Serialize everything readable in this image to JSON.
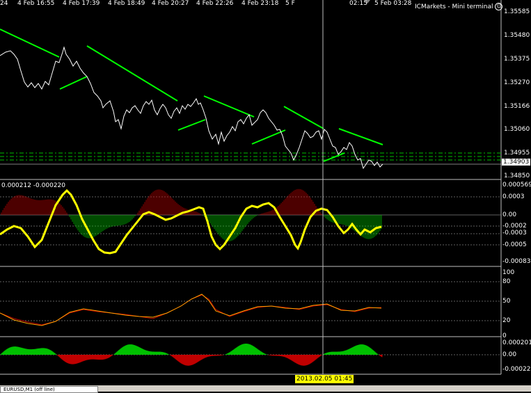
{
  "terminal": {
    "title": "ICMarkets - Mini terminal",
    "smiley": "☺"
  },
  "price_axis": [
    "1.35585",
    "1.35480",
    "1.35375",
    "1.35270",
    "1.35166",
    "1.35060",
    "1.34955",
    "1.34850"
  ],
  "current_price": "1.34903",
  "macd": {
    "header": "0.000212 -0.000220",
    "axis": [
      "0.000569",
      "0.0003",
      "0.00",
      "-0.0002",
      "-0.0003",
      "-0.0005",
      "-0.00083"
    ]
  },
  "oscillator_axis": [
    "100",
    "80",
    "50",
    "20",
    "0"
  ],
  "ao_axis": [
    "0.000201",
    "0.00",
    "-0.000222"
  ],
  "time_axis": [
    "24",
    "4 Feb 16:55",
    "4 Feb 17:39",
    "4 Feb 18:49",
    "4 Feb 20:27",
    "4 Feb 22:26",
    "4 Feb 23:18",
    "5 F",
    "02:15",
    "5 Feb 03:28"
  ],
  "crosshair_time": "2013.02.05 01:45",
  "bottom_tab": "EURUSD,M1 (off line)",
  "colors": {
    "price_line": "#ffffff",
    "trend_line": "#00ff00",
    "level_line": "#00c000",
    "macd_signal": "#ffff00",
    "macd_hist_up": "#c00000",
    "macd_hist_down": "#00c000",
    "osc_line": "#ffa500",
    "ao_up": "#00c000",
    "ao_down": "#c00000",
    "crosshair": "#c0c0c0"
  }
}
